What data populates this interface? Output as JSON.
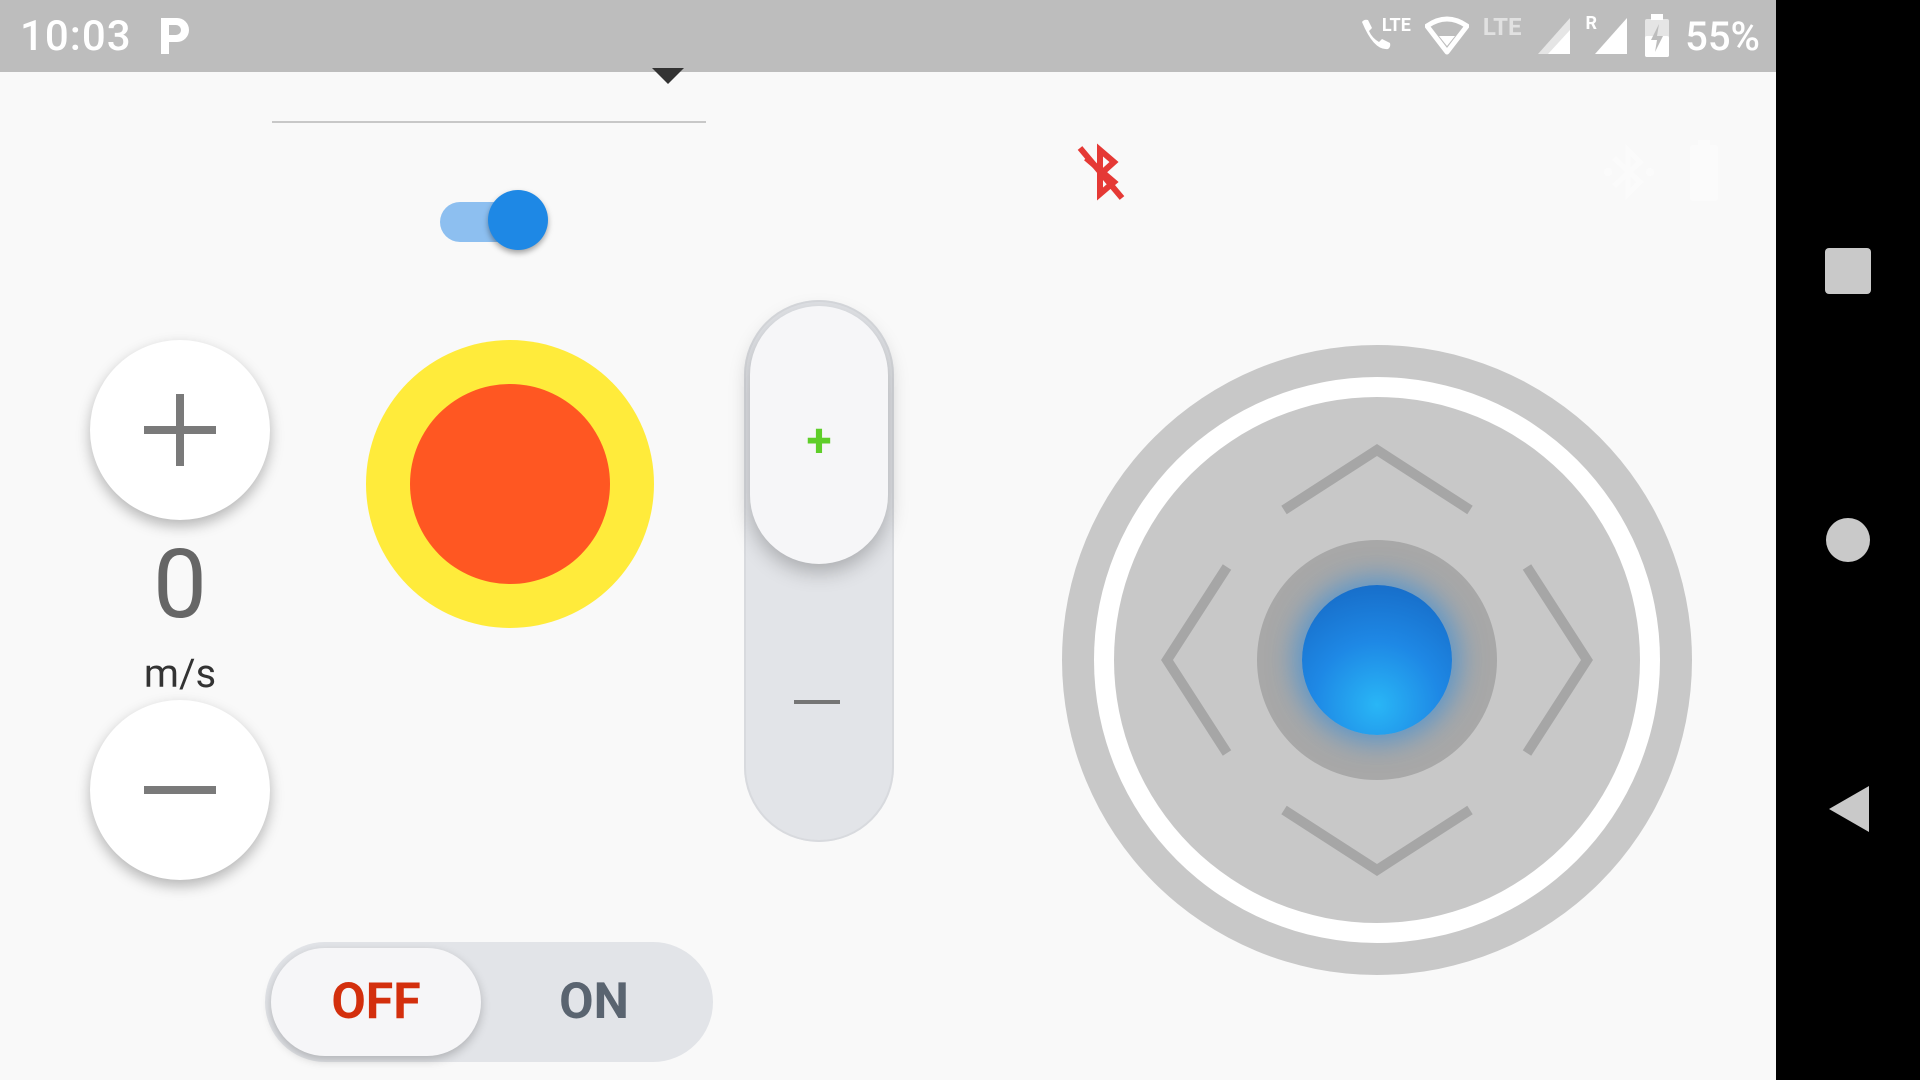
{
  "status_bar": {
    "time": "10:03",
    "network_label_1": "LTE",
    "network_label_2": "LTE",
    "roaming_label": "R",
    "battery_percent": "55%"
  },
  "controls": {
    "toggle_switch_on": true,
    "speed_value": "0",
    "speed_unit": "m/s",
    "vertical_slider_plus": "+",
    "power_off_label": "OFF",
    "power_on_label": "ON",
    "power_selected": "OFF"
  },
  "icons": {
    "bluetooth_status": "bluetooth-disabled-icon",
    "joystick_directions": [
      "up",
      "right",
      "down",
      "left"
    ]
  },
  "colors": {
    "accent_blue": "#1e88e5",
    "stop_yellow": "#ffeb3b",
    "stop_orange": "#ff5722",
    "off_red": "#d32f0d",
    "plus_green": "#5fce2a",
    "bluetooth_red": "#e53935"
  }
}
